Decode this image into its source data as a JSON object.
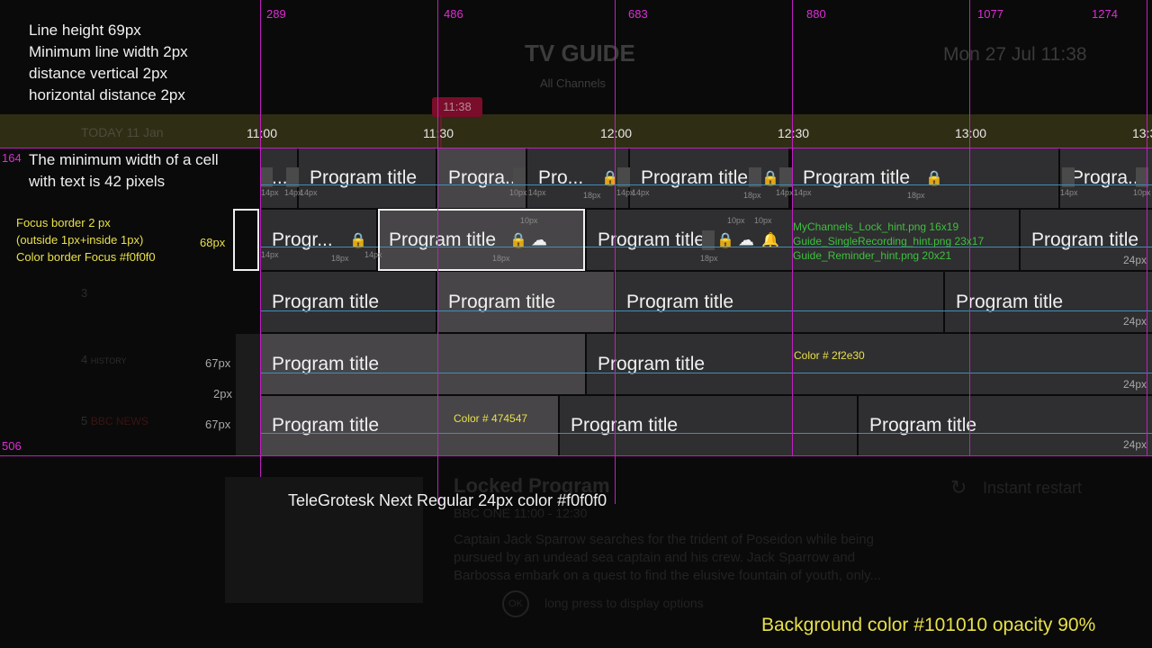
{
  "guide": {
    "title": "TV GUIDE",
    "subtitle": "All Channels",
    "datetime": "Mon 27 Jul 11:38",
    "today": "TODAY 11 Jan",
    "now_time": "11:38"
  },
  "timeline": [
    "11:00",
    "11:30",
    "12:00",
    "12:30",
    "13:00",
    "13:3"
  ],
  "guides_top": [
    "289",
    "486",
    "683",
    "880",
    "1077",
    "1274"
  ],
  "guides_left": [
    "164",
    "506"
  ],
  "notes": {
    "line_block": [
      "Line height 69px",
      "Minimum line width 2px",
      "distance vertical 2px",
      "horizontal distance 2px"
    ],
    "min_width": [
      "The minimum width of a cell",
      "with text is 42 pixels"
    ],
    "focus": [
      "Focus border 2 px",
      "(outside 1px+inside 1px)",
      "Color border Focus #f0f0f0"
    ],
    "font": "TeleGrotesk Next  Regular  24px color #f0f0f0",
    "background": "Background color #101010 opacity 90%"
  },
  "dims": {
    "h68": "68px",
    "h67a": "67px",
    "h2": "2px",
    "h67b": "67px",
    "px24": "24px",
    "px14": "14px",
    "px18": "18px",
    "px10": "10px"
  },
  "colors": {
    "c1": "Color # 2f2e30",
    "c2": "Color # 474547",
    "cell_dark": "#2f2e30",
    "cell_light": "#474547",
    "focus": "#f0f0f0",
    "guide": "#c21fc2"
  },
  "hints": [
    "MyChannels_Lock_hint.png 16x19",
    "Guide_SingleRecording_hint.png 23x17",
    "Guide_Reminder_hint.png 20x21"
  ],
  "rows": {
    "r1": [
      "...",
      "Program title",
      "Progra...",
      "Pro...",
      "Program title",
      "Program title",
      "Progra..."
    ],
    "r2": [
      "Progr...",
      "Program title",
      "Program title",
      "Program title"
    ],
    "r3": [
      "Program title",
      "Program title",
      "Program title",
      "Program title"
    ],
    "r4": [
      "Program title",
      "Program title"
    ],
    "r5": [
      "Program title",
      "Program title",
      "Program title"
    ]
  },
  "channels": [
    "3",
    "4",
    "5"
  ],
  "channel_logos": [
    "HISTORY",
    "BBC NEWS"
  ],
  "detail": {
    "title": "Locked Program",
    "meta": "BBC ONE 11:00 - 12:30",
    "desc_1": "Captain Jack Sparrow searches for the trident of Poseidon while being",
    "desc_2": "pursued by an undead sea captain and his crew. Jack Sparrow and",
    "desc_3": "Barbossa embark on a quest to find the elusive fountain of youth, only...",
    "ok": "OK",
    "hint": "long press to display options",
    "restart": "Instant restart"
  },
  "icons": {
    "lock": "lock-icon",
    "cloud": "cloud-recording-icon",
    "bell": "reminder-bell-icon",
    "restart": "restart-icon"
  }
}
